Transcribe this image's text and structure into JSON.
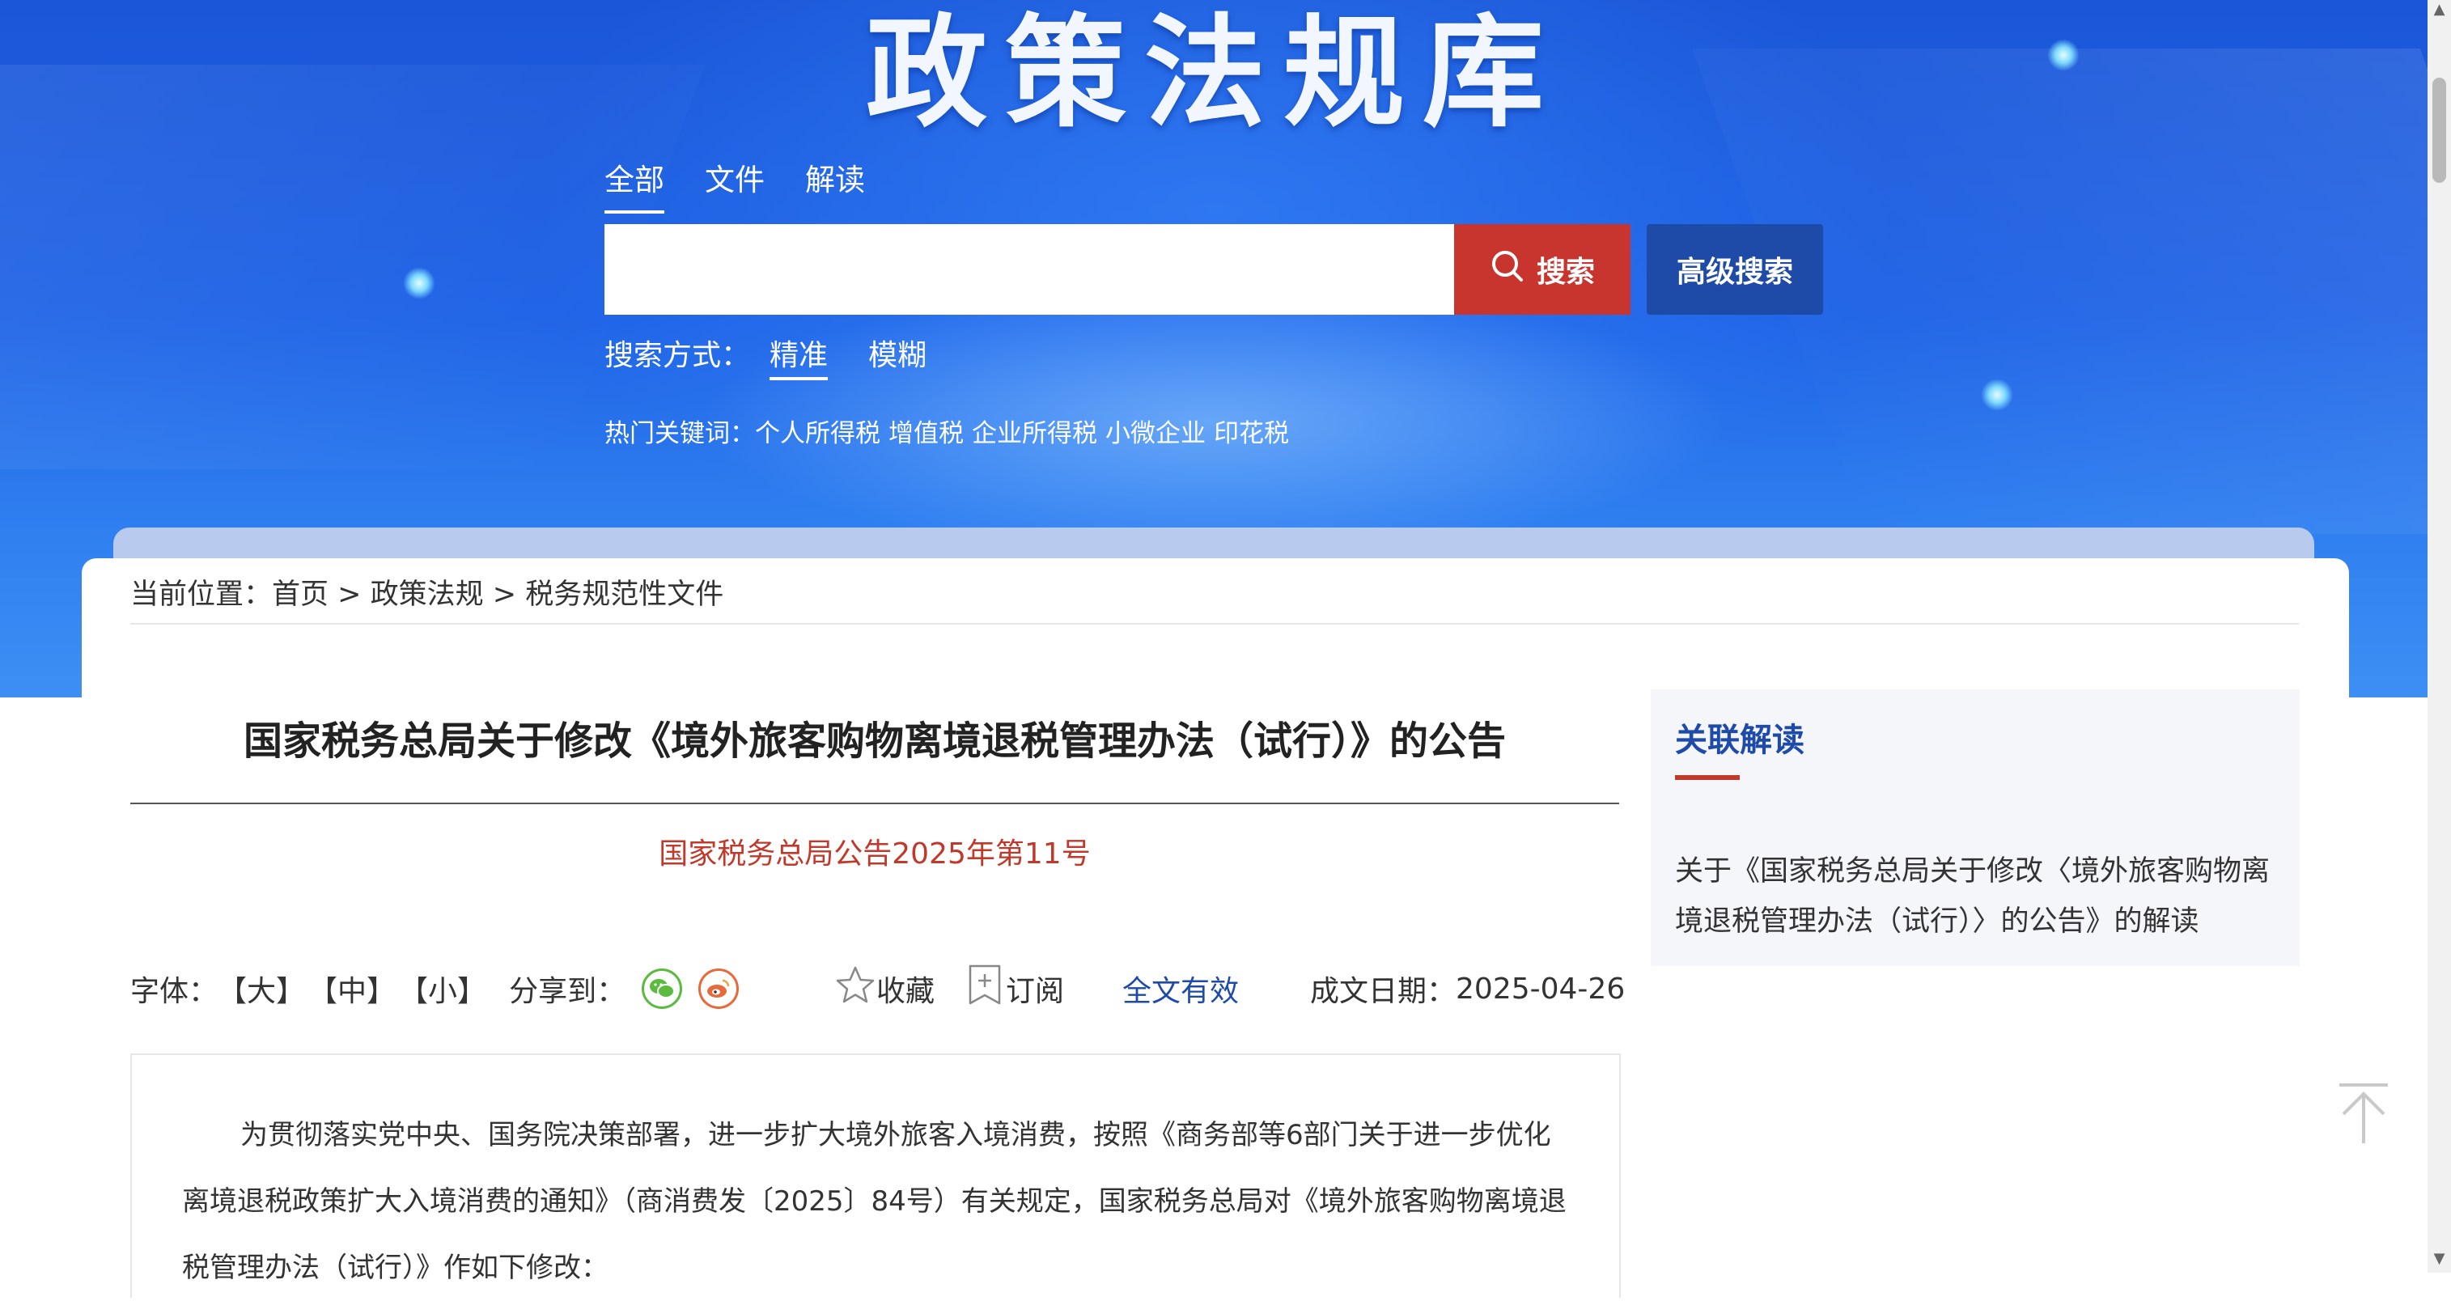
{
  "site": {
    "title": "政策法规库"
  },
  "tabs": [
    {
      "label": "全部",
      "active": true
    },
    {
      "label": "文件",
      "active": false
    },
    {
      "label": "解读",
      "active": false
    }
  ],
  "search": {
    "placeholder": "",
    "value": "",
    "button_label": "搜索",
    "advanced_label": "高级搜索",
    "mode_label": "搜索方式：",
    "modes": [
      {
        "label": "精准",
        "active": true
      },
      {
        "label": "模糊",
        "active": false
      }
    ],
    "hot_label": "热门关键词：",
    "hot_keywords": [
      "个人所得税",
      "增值税",
      "企业所得税",
      "小微企业",
      "印花税"
    ]
  },
  "breadcrumb": {
    "prefix": "当前位置：",
    "items": [
      "首页",
      "政策法规",
      "税务规范性文件"
    ],
    "separator": ">"
  },
  "document": {
    "title": "国家税务总局关于修改《境外旅客购物离境退税管理办法（试行）》的公告",
    "number": "国家税务总局公告2025年第11号",
    "font_label": "字体：",
    "font_sizes": [
      "【大】",
      "【中】",
      "【小】"
    ],
    "share_label": "分享到：",
    "favorite_label": "收藏",
    "subscribe_label": "订阅",
    "status": "全文有效",
    "date_label": "成文日期：",
    "date": "2025-04-26",
    "body": "为贯彻落实党中央、国务院决策部署，进一步扩大境外旅客入境消费，按照《商务部等6部门关于进一步优化离境退税政策扩大入境消费的通知》（商消费发〔2025〕84号）有关规定，国家税务总局对《境外旅客购物离境退税管理办法（试行）》作如下修改："
  },
  "sidebar": {
    "title": "关联解读",
    "links": [
      "关于《国家税务总局关于修改〈境外旅客购物离境退税管理办法（试行）〉的公告》的解读"
    ]
  },
  "colors": {
    "banner_blue": "#1f63e6",
    "search_red": "#c8352e",
    "advanced_navy": "#1e4aa8",
    "doc_number_red": "#c0392b",
    "status_blue": "#1e4aa8"
  },
  "icons": {
    "search": "search-icon",
    "wechat": "wechat-icon",
    "weibo": "weibo-icon",
    "favorite": "star-icon",
    "subscribe": "subscribe-icon",
    "back_to_top": "arrow-up-icon"
  }
}
